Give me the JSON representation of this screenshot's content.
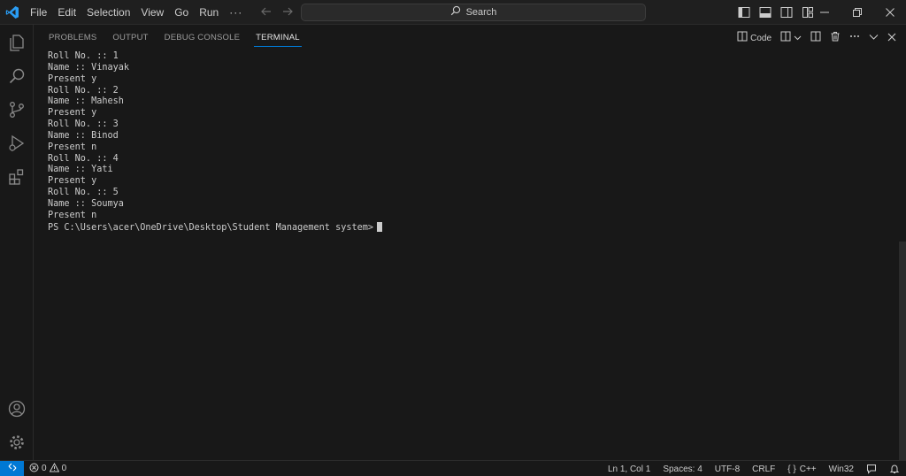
{
  "titlebar": {
    "menu": [
      "File",
      "Edit",
      "Selection",
      "View",
      "Go",
      "Run"
    ],
    "menu_more": "···",
    "search_label": "Search"
  },
  "panel": {
    "tabs": [
      {
        "label": "PROBLEMS",
        "active": false
      },
      {
        "label": "OUTPUT",
        "active": false
      },
      {
        "label": "DEBUG CONSOLE",
        "active": false
      },
      {
        "label": "TERMINAL",
        "active": true
      }
    ],
    "terminal_type_label": "Code"
  },
  "terminal": {
    "lines": [
      "Roll No. :: 1",
      "Name :: Vinayak",
      "Present y",
      "Roll No. :: 2",
      "Name :: Mahesh",
      "Present y",
      "Roll No. :: 3",
      "Name :: Binod",
      "Present n",
      "Roll No. :: 4",
      "Name :: Yati",
      "Present y",
      "Roll No. :: 5",
      "Name :: Soumya",
      "Present n"
    ],
    "prompt": "PS C:\\Users\\acer\\OneDrive\\Desktop\\Student Management system>"
  },
  "statusbar": {
    "errors": "0",
    "warnings": "0",
    "cursor_position": "Ln 1, Col 1",
    "indentation": "Spaces: 4",
    "encoding": "UTF-8",
    "line_ending": "CRLF",
    "language": "C++",
    "platform": "Win32"
  },
  "colors": {
    "accent": "#0078d4",
    "background": "#181818",
    "titlebar": "#1f1f1f",
    "text": "#cccccc"
  },
  "icons": {
    "activity_bar": [
      "explorer-icon",
      "search-icon",
      "source-control-icon",
      "run-debug-icon",
      "extensions-icon",
      "accounts-icon",
      "manage-gear-icon"
    ]
  }
}
